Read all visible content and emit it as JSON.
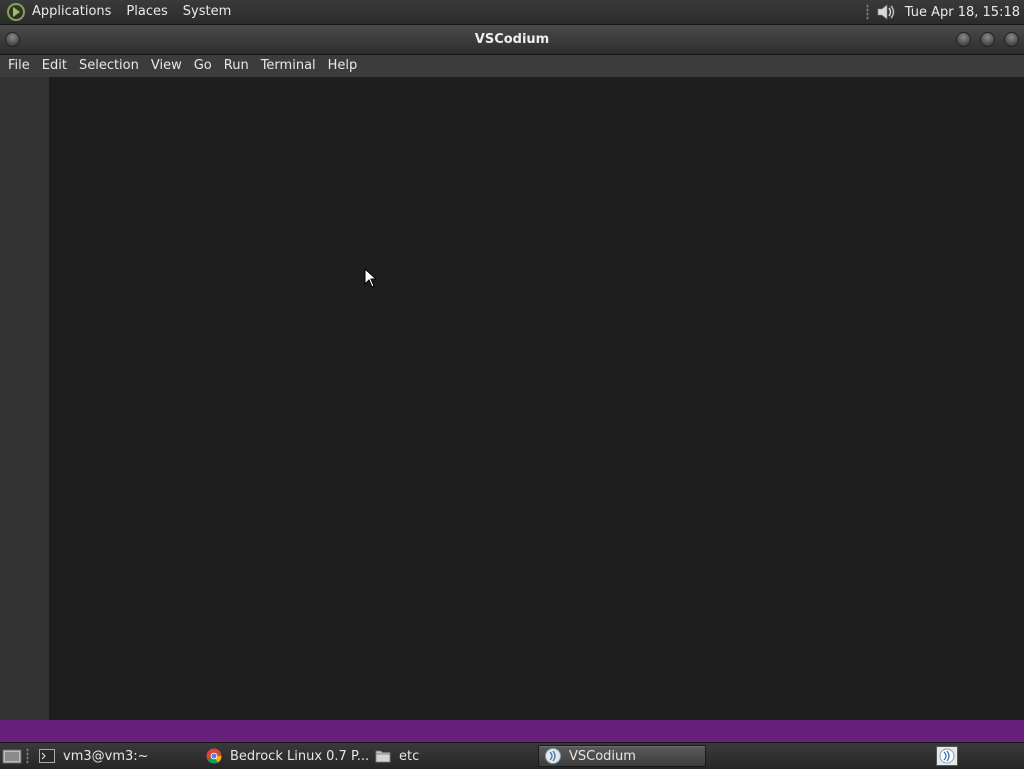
{
  "top_panel": {
    "menus": [
      "Applications",
      "Places",
      "System"
    ],
    "clock": "Tue Apr 18, 15:18",
    "icons": [
      "distro-logo-icon",
      "volume-icon"
    ]
  },
  "window": {
    "title": "VSCodium"
  },
  "menubar": {
    "items": [
      "File",
      "Edit",
      "Selection",
      "View",
      "Go",
      "Run",
      "Terminal",
      "Help"
    ]
  },
  "statusbar": {
    "color": "#68217a"
  },
  "taskbar": {
    "tasks": [
      {
        "label": "vm3@vm3:~",
        "icon": "terminal-icon",
        "active": false
      },
      {
        "label": "Bedrock Linux 0.7 P...",
        "icon": "chrome-icon",
        "active": false
      },
      {
        "label": "etc",
        "icon": "folder-icon",
        "active": false
      },
      {
        "label": "VSCodium",
        "icon": "vscodium-icon",
        "active": true
      }
    ]
  },
  "colors": {
    "editor_bg": "#1e1e1e",
    "activity_bar_bg": "#333333",
    "menubar_bg": "#3c3c3c",
    "statusbar_bg": "#68217a"
  }
}
